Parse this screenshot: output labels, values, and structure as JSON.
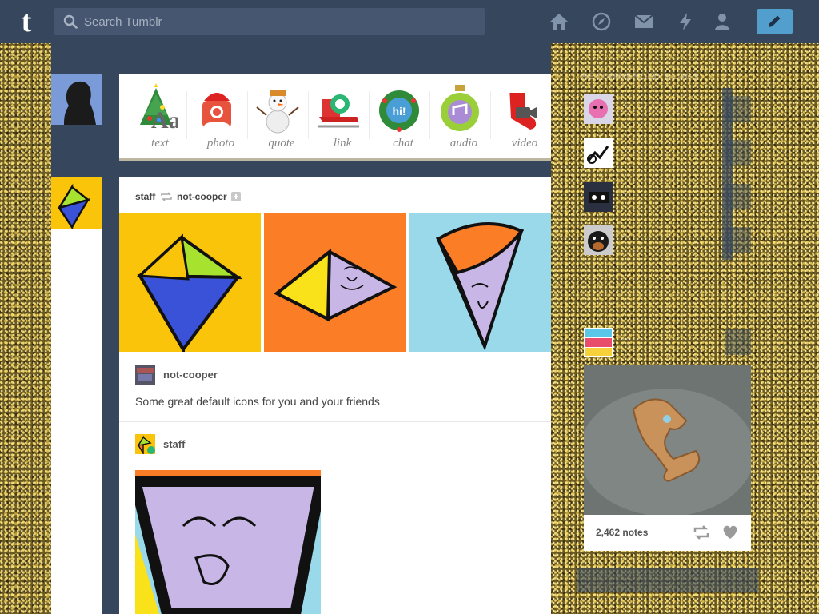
{
  "app": {
    "name": "Tumblr"
  },
  "header": {
    "search_placeholder": "Search Tumblr",
    "nav": [
      "home-icon",
      "explore-icon",
      "inbox-icon",
      "activity-icon",
      "account-icon"
    ],
    "compose_icon": "pencil-icon"
  },
  "post_types": [
    {
      "label": "text",
      "icon": "text-tree-icon"
    },
    {
      "label": "photo",
      "icon": "photo-santa-icon"
    },
    {
      "label": "quote",
      "icon": "quote-snowman-icon"
    },
    {
      "label": "link",
      "icon": "link-sleigh-icon"
    },
    {
      "label": "chat",
      "icon": "chat-wreath-icon"
    },
    {
      "label": "audio",
      "icon": "audio-ornament-icon"
    },
    {
      "label": "video",
      "icon": "video-stocking-icon"
    }
  ],
  "post": {
    "author": "staff",
    "reblogged_from": "not-cooper",
    "source_name": "not-cooper",
    "caption": "Some great default icons for you and your friends",
    "reblogger": "staff"
  },
  "sidebar": {
    "title": "RECOMMENDED BLOGS",
    "recommended": [
      {
        "name": "...",
        "sub": ""
      },
      {
        "name": "...",
        "sub": ""
      },
      {
        "name": "...",
        "sub": ""
      },
      {
        "name": "...",
        "sub": ""
      }
    ],
    "radar_blog": {
      "name": "...",
      "sub": ""
    },
    "radar": {
      "notes": "2,462 notes"
    }
  },
  "colors": {
    "header": "#36465d",
    "compose": "#529ecc",
    "kite_yellow": "#f9c40a",
    "kite_orange": "#fb7d26",
    "kite_blue": "#99d9ea"
  }
}
